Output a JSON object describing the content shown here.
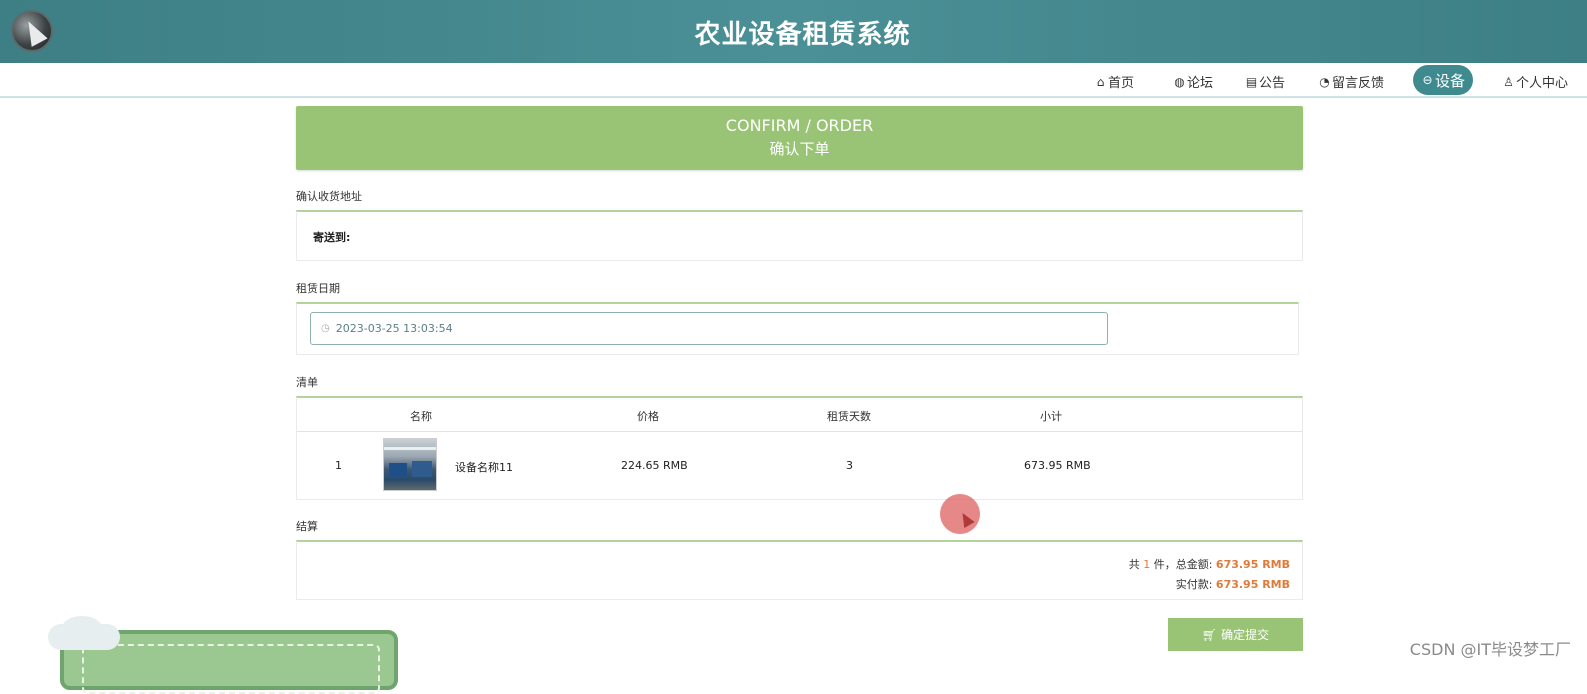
{
  "header": {
    "title": "农业设备租赁系统"
  },
  "nav": {
    "items": [
      {
        "icon": "home-icon",
        "glyph": "⌂",
        "label": "首页"
      },
      {
        "icon": "globe-icon",
        "glyph": "◍",
        "label": "论坛"
      },
      {
        "icon": "notice-icon",
        "glyph": "▤",
        "label": "公告"
      },
      {
        "icon": "feedback-icon",
        "glyph": "◔",
        "label": "留言反馈"
      },
      {
        "icon": "device-icon",
        "glyph": "⊖",
        "label": "设备",
        "active": true
      },
      {
        "icon": "user-icon",
        "glyph": "♙",
        "label": "个人中心"
      }
    ]
  },
  "banner": {
    "en": "CONFIRM / ORDER",
    "cn": "确认下单"
  },
  "address": {
    "section_label": "确认收货地址",
    "to_label": "寄送到:"
  },
  "rental_date": {
    "section_label": "租赁日期",
    "value": "2023-03-25 13:03:54"
  },
  "list": {
    "section_label": "清单",
    "columns": [
      "名称",
      "价格",
      "租赁天数",
      "小计"
    ],
    "rows": [
      {
        "index": "1",
        "name": "设备名称11",
        "price": "224.65 RMB",
        "days": "3",
        "subtotal": "673.95 RMB"
      }
    ]
  },
  "settlement": {
    "section_label": "结算",
    "count_prefix": "共",
    "count": "1",
    "count_suffix": "件，总金额:",
    "total": "673.95 RMB",
    "paid_label": "实付款:",
    "paid": "673.95 RMB"
  },
  "submit": {
    "label": "确定提交",
    "icon": "cart-icon"
  },
  "watermark": "CSDN @IT毕设梦工厂",
  "colors": {
    "header": "#3f8a8f",
    "accent_green": "#99c476",
    "amount": "#e07a3a"
  }
}
